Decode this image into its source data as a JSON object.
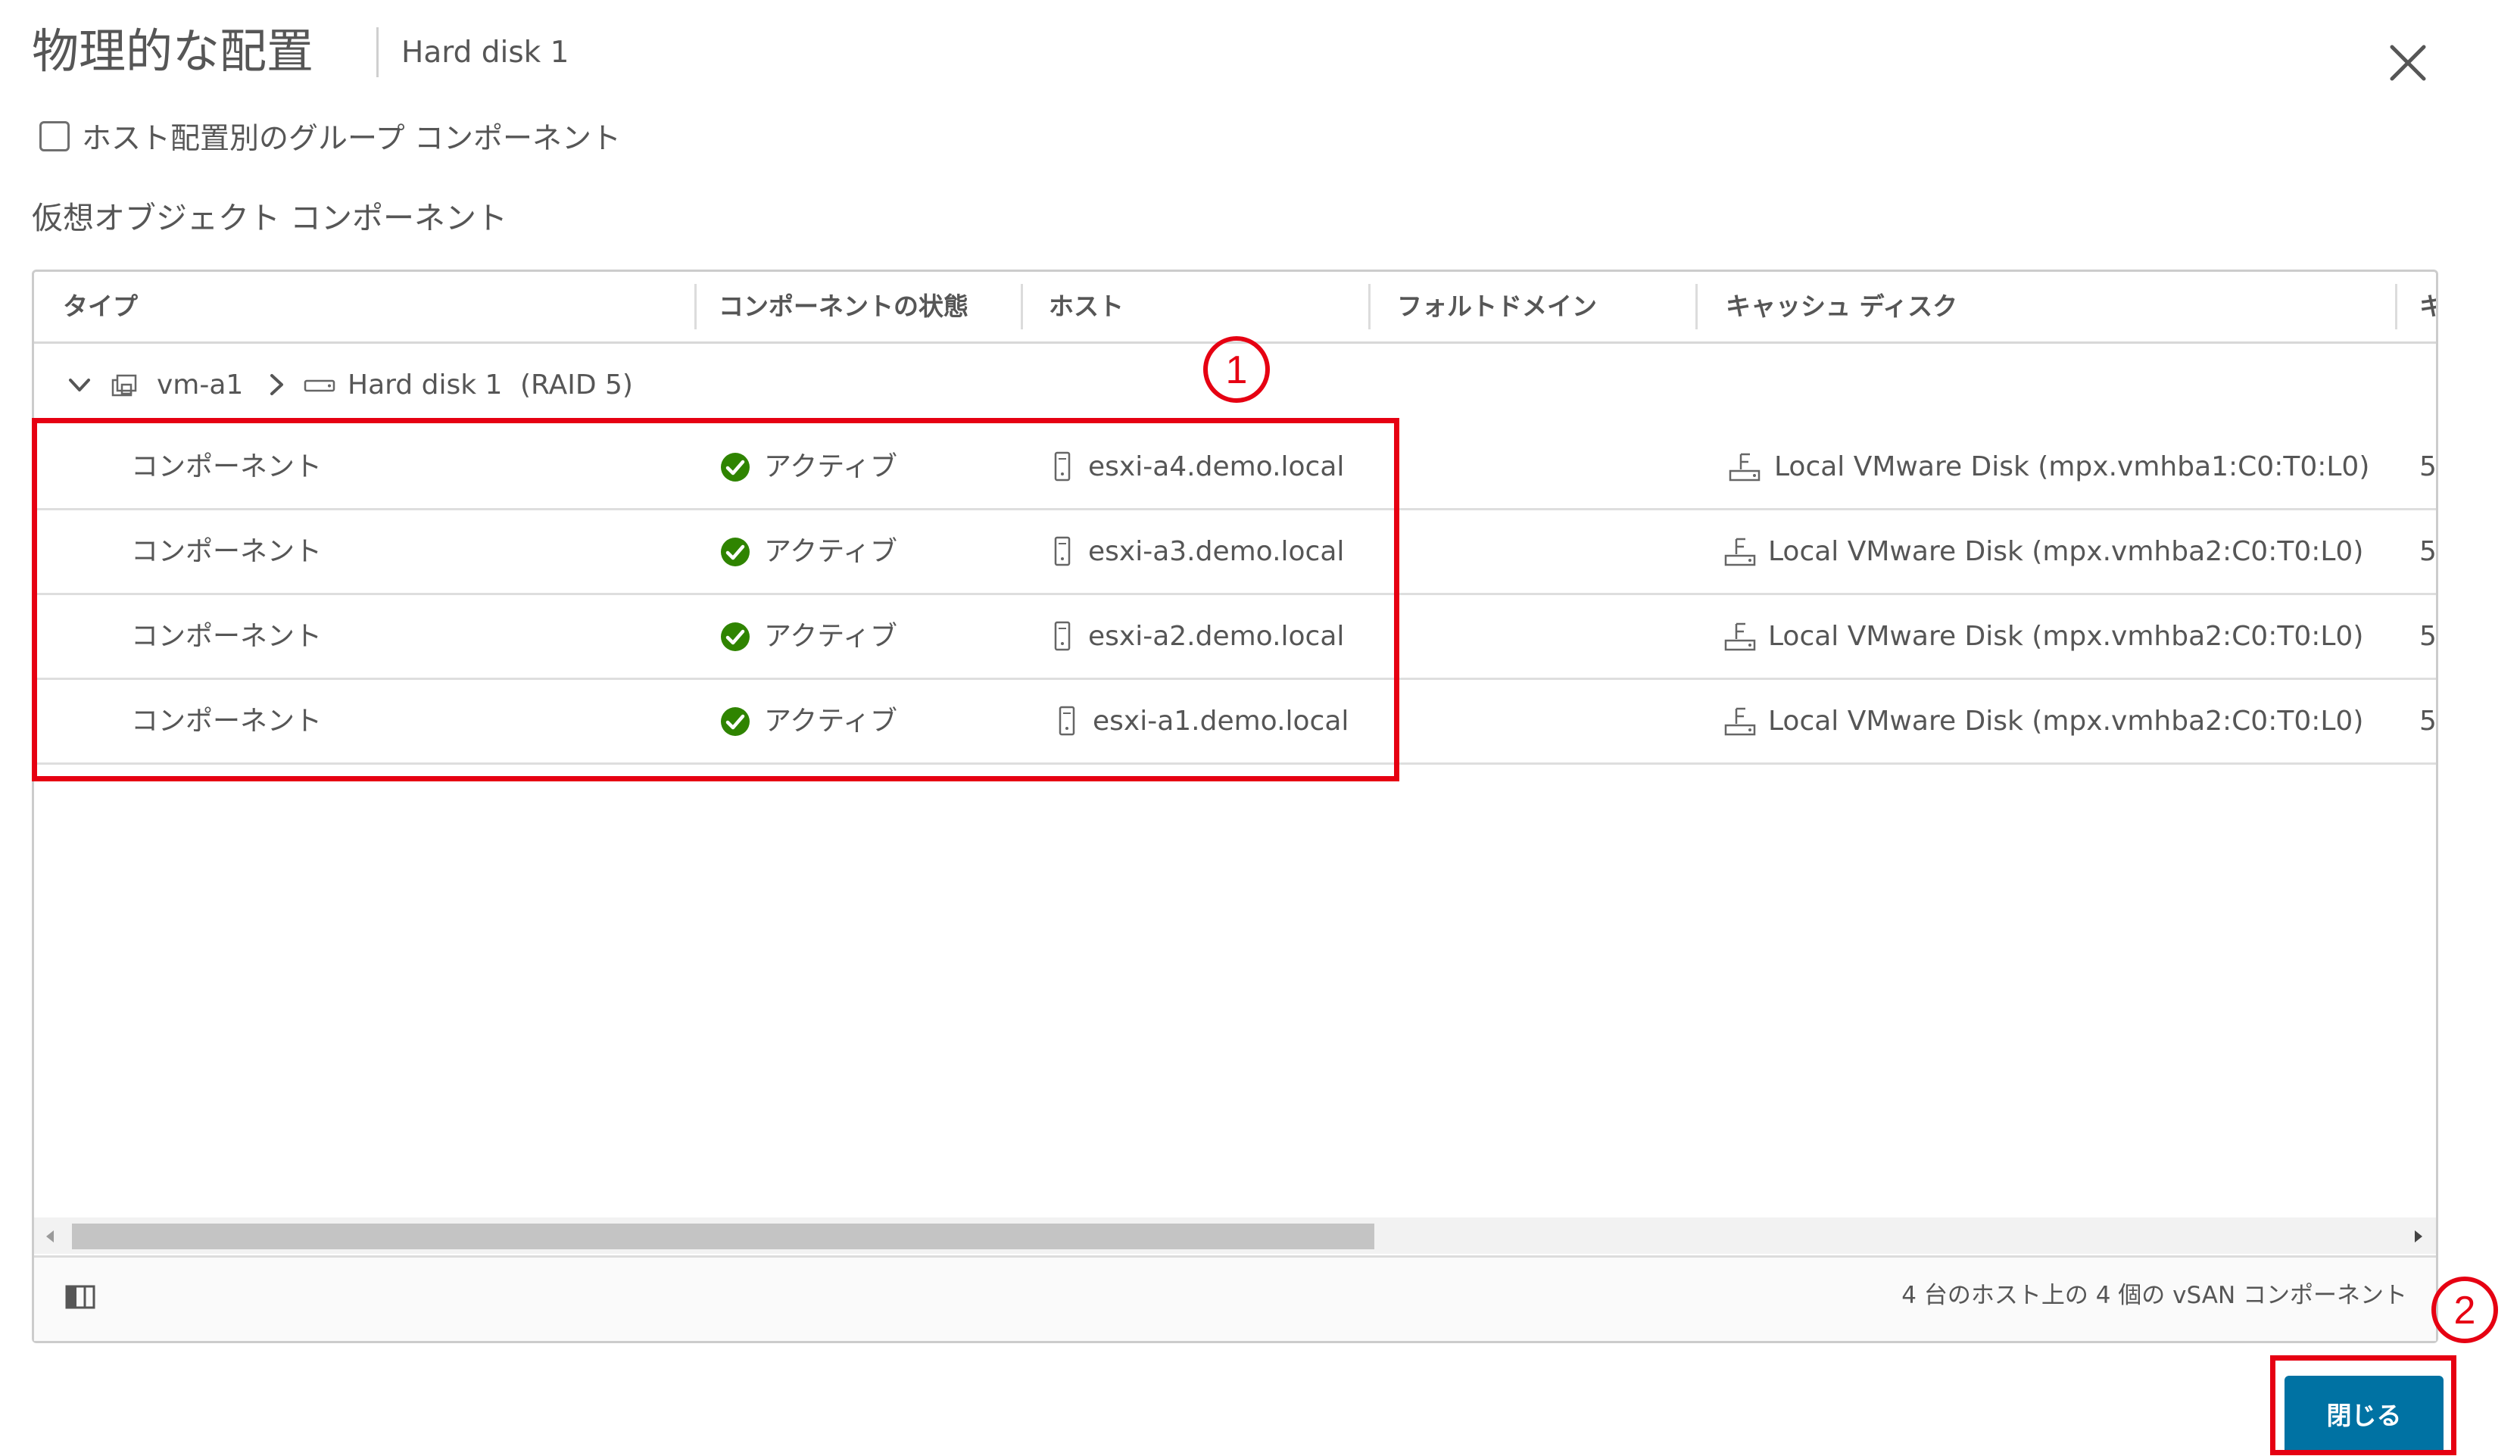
{
  "dialog": {
    "title": "物理的な配置",
    "subtitle": "Hard disk 1",
    "group_by_host_label": "ホスト配置別のグループ コンポーネント",
    "section_label": "仮想オブジェクト コンポーネント"
  },
  "table": {
    "columns": [
      "タイプ",
      "コンポーネントの状態",
      "ホスト",
      "フォルトドメイン",
      "キャッシュ ディスク",
      "キ"
    ],
    "group": {
      "vm_name": "vm-a1",
      "disk_name": "Hard disk 1",
      "raid": "(RAID 5)"
    },
    "rows": [
      {
        "type": "コンポーネント",
        "state": "アクティブ",
        "host": "esxi-a4.demo.local",
        "cache_disk": "Local VMware Disk (mpx.vmhba1:C0:T0:L0)",
        "next_col": "5"
      },
      {
        "type": "コンポーネント",
        "state": "アクティブ",
        "host": "esxi-a3.demo.local",
        "cache_disk": "Local VMware Disk (mpx.vmhba2:C0:T0:L0)",
        "next_col": "5"
      },
      {
        "type": "コンポーネント",
        "state": "アクティブ",
        "host": "esxi-a2.demo.local",
        "cache_disk": "Local VMware Disk (mpx.vmhba2:C0:T0:L0)",
        "next_col": "5"
      },
      {
        "type": "コンポーネント",
        "state": "アクティブ",
        "host": "esxi-a1.demo.local",
        "cache_disk": "Local VMware Disk (mpx.vmhba2:C0:T0:L0)",
        "next_col": "5"
      }
    ],
    "footer_text": "4 台のホスト上の 4 個の vSAN コンポーネント"
  },
  "buttons": {
    "close_label": "閉じる"
  },
  "annotations": [
    "①",
    "②"
  ],
  "colors": {
    "accent": "#0072a3",
    "status_ok": "#2f8400",
    "annotation": "#e60012"
  },
  "icons": {
    "close": "close-icon",
    "expand": "chevron-down-icon",
    "breadcrumb": "chevron-right-icon",
    "vm": "vm-icon",
    "disk": "hard-disk-icon",
    "status": "check-circle-icon",
    "host": "host-server-icon",
    "cache": "storage-disk-icon",
    "columns": "column-toggle-icon"
  }
}
